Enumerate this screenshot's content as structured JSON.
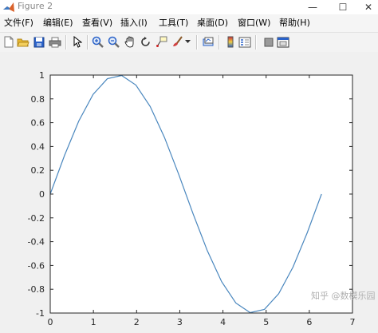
{
  "window": {
    "title": "Figure 2",
    "minimize_glyph": "—",
    "maximize_glyph": "☐",
    "close_glyph": "✕"
  },
  "menu": {
    "items": [
      {
        "label": "文件(F)"
      },
      {
        "label": "编辑(E)"
      },
      {
        "label": "查看(V)"
      },
      {
        "label": "插入(I)"
      },
      {
        "label": "工具(T)"
      },
      {
        "label": "桌面(D)"
      },
      {
        "label": "窗口(W)"
      },
      {
        "label": "帮助(H)"
      }
    ]
  },
  "toolbar": {
    "icons": [
      "new-figure-icon",
      "open-file-icon",
      "save-icon",
      "print-icon",
      "select-arrow-icon",
      "zoom-in-icon",
      "zoom-out-icon",
      "pan-hand-icon",
      "rotate-3d-icon",
      "data-cursor-icon",
      "brush-icon",
      "link-plot-icon",
      "colorbar-icon",
      "legend-icon",
      "hide-plot-tools-icon",
      "show-plot-tools-icon"
    ],
    "colors": {
      "blue": "#2a62c9",
      "yellow": "#e8b830",
      "gray": "#6b6b6b"
    }
  },
  "watermark": "知乎 @数模乐园",
  "chart_data": {
    "type": "line",
    "title": "",
    "xlabel": "",
    "ylabel": "",
    "xlim": [
      0,
      7
    ],
    "ylim": [
      -1,
      1
    ],
    "xticks": [
      "0",
      "1",
      "2",
      "3",
      "4",
      "5",
      "6",
      "7"
    ],
    "yticks": [
      "-1",
      "-0.8",
      "-0.6",
      "-0.4",
      "-0.2",
      "0",
      "0.2",
      "0.4",
      "0.6",
      "0.8",
      "1"
    ],
    "grid": false,
    "line_color": "#4a87be",
    "series": [
      {
        "x": [
          0,
          0.3307,
          0.6614,
          0.9921,
          1.3228,
          1.6535,
          1.9842,
          2.3149,
          2.6456,
          2.9762,
          3.3069,
          3.6376,
          3.9683,
          4.299,
          4.6297,
          4.9604,
          5.2911,
          5.6218,
          5.9525,
          6.2832
        ],
        "y": [
          0,
          0.3247,
          0.6142,
          0.8372,
          0.9694,
          0.9966,
          0.9158,
          0.7357,
          0.4759,
          0.1646,
          -0.1646,
          -0.4759,
          -0.7357,
          -0.9158,
          -0.9966,
          -0.9694,
          -0.8372,
          -0.6142,
          -0.3247,
          0
        ]
      }
    ]
  }
}
